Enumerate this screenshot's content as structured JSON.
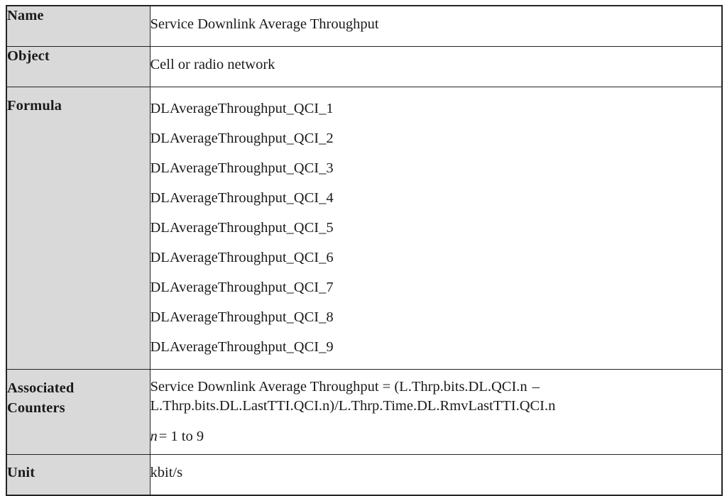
{
  "document": {
    "type": "kpi-definition-table",
    "colors": {
      "label_background": "#d9d9d9",
      "value_background": "#ffffff",
      "border": "#242424",
      "text": "#1a1a1a"
    }
  },
  "table": {
    "rows": [
      {
        "label": "Name",
        "value": "Service Downlink Average Throughput"
      },
      {
        "label": "Object",
        "value": "Cell or radio network"
      },
      {
        "label": "Formula",
        "lines": [
          "DLAverageThroughput_QCI_1",
          "DLAverageThroughput_QCI_2",
          "DLAverageThroughput_QCI_3",
          "DLAverageThroughput_QCI_4",
          "DLAverageThroughput_QCI_5",
          "DLAverageThroughput_QCI_6",
          "DLAverageThroughput_QCI_7",
          "DLAverageThroughput_QCI_8",
          "DLAverageThroughput_QCI_9"
        ]
      },
      {
        "label": "Associated Counters",
        "label_line_1": "Associated",
        "label_line_2": "Counters",
        "formula_line_1": "Service Downlink Average Throughput = (L.Thrp.bits.DL.QCI.n",
        "formula_dash": "–",
        "formula_line_2": "L.Thrp.bits.DL.LastTTI.QCI.n)/L.Thrp.Time.DL.RmvLastTTI.QCI.n",
        "range_var": "n",
        "range_text": "= 1 to 9"
      },
      {
        "label": "Unit",
        "value": "kbit/s"
      }
    ]
  }
}
